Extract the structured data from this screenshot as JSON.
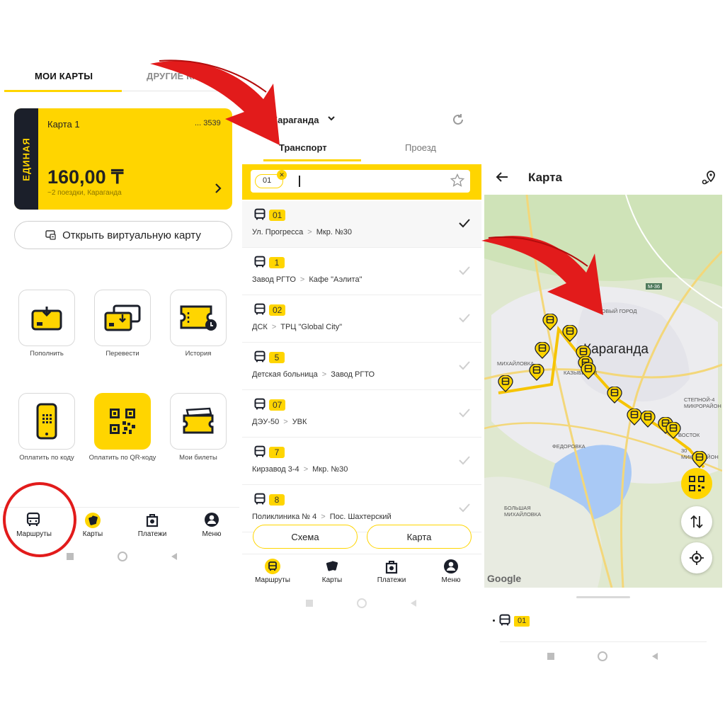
{
  "screen1": {
    "tabs": [
      "МОИ КАРТЫ",
      "ДРУГИЕ КАРТЫ"
    ],
    "card": {
      "side_label": "ЕДИНАЯ",
      "name": "Карта 1",
      "number": "... 3539",
      "balance": "160,00 ₸",
      "subtitle": "~2 поездки, Караганда"
    },
    "virtual_button": "Открыть виртуальную карту",
    "actions": [
      {
        "label": "Пополнить",
        "icon": "topup-icon"
      },
      {
        "label": "Перевести",
        "icon": "transfer-icon"
      },
      {
        "label": "История",
        "icon": "history-icon"
      },
      {
        "label": "Оплатить по коду",
        "icon": "phone-code-icon"
      },
      {
        "label": "Оплатить по QR-коду",
        "icon": "qr-code-icon"
      },
      {
        "label": "Мои билеты",
        "icon": "tickets-icon"
      }
    ],
    "nav": [
      "Маршруты",
      "Карты",
      "Платежи",
      "Меню"
    ]
  },
  "screen2": {
    "city": "Караганда",
    "tabs": [
      "Транспорт",
      "Проезд"
    ],
    "search_chip": "01",
    "routes": [
      {
        "num": "01",
        "from": "Ул. Прогресса",
        "to": "Мкр. №30",
        "selected": true
      },
      {
        "num": "1",
        "from": "Завод РГТО",
        "to": "Кафе \"Аэлита\"",
        "selected": false
      },
      {
        "num": "02",
        "from": "ДСК",
        "to": "ТРЦ \"Global City\"",
        "selected": false
      },
      {
        "num": "5",
        "from": "Детская больница",
        "to": "Завод РГТО",
        "selected": false
      },
      {
        "num": "07",
        "from": "ДЭУ-50",
        "to": "УВК",
        "selected": false
      },
      {
        "num": "7",
        "from": "Кирзавод 3-4",
        "to": "Мкр. №30",
        "selected": false
      },
      {
        "num": "8",
        "from": "Поликлиника № 4",
        "to": "Пос. Шахтерский",
        "selected": false
      }
    ],
    "buttons": [
      "Схема",
      "Карта"
    ],
    "nav": [
      "Маршруты",
      "Карты",
      "Платежи",
      "Меню"
    ]
  },
  "screen3": {
    "title": "Карта",
    "map_labels": {
      "city": "Караганда",
      "new_city": "НОВЫЙ ГОРОД",
      "mikhaylovka": "МИХАЙЛОВКА",
      "kazybek": "КАЗЫБЕК БИ",
      "fedorovka": "ФЕДОРОВКА",
      "big_mikhaylovka": "БОЛЬШАЯ МИХАЙЛОВКА",
      "stepnoy": "СТЕПНОЙ-4 МИКРОРАЙОН",
      "mkr30": "30 МИКРОРАЙОН",
      "road": "М-36",
      "google": "Google",
      "vostok": "ВОСТОК"
    },
    "bottom_route": "01"
  },
  "colors": {
    "accent": "#FFD500",
    "dark": "#1b1f2a",
    "arrow": "#e21b1b"
  }
}
